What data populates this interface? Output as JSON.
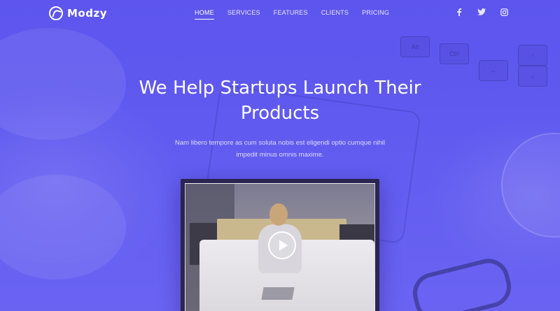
{
  "brand": {
    "name": "Modzy"
  },
  "nav": {
    "items": [
      {
        "label": "HOME",
        "active": true
      },
      {
        "label": "SERVICES",
        "active": false
      },
      {
        "label": "FEATURES",
        "active": false
      },
      {
        "label": "CLIENTS",
        "active": false
      },
      {
        "label": "PRICING",
        "active": false
      }
    ]
  },
  "social": {
    "icons": [
      "facebook-icon",
      "twitter-icon",
      "instagram-icon"
    ],
    "glyphs": [
      "f",
      "🐦",
      "◎"
    ]
  },
  "hero": {
    "title": "We Help Startups Launch Their Products",
    "subtitle": "Nam libero tempore as cum soluta nobis est eligendi optio cumque nihil impedit minus omnis maxime."
  },
  "keyboard": {
    "keys": [
      "Alt",
      "Ctrl",
      "↑",
      "←",
      "↓"
    ]
  },
  "colors": {
    "accent": "#5b55ee",
    "text": "#ffffff"
  }
}
